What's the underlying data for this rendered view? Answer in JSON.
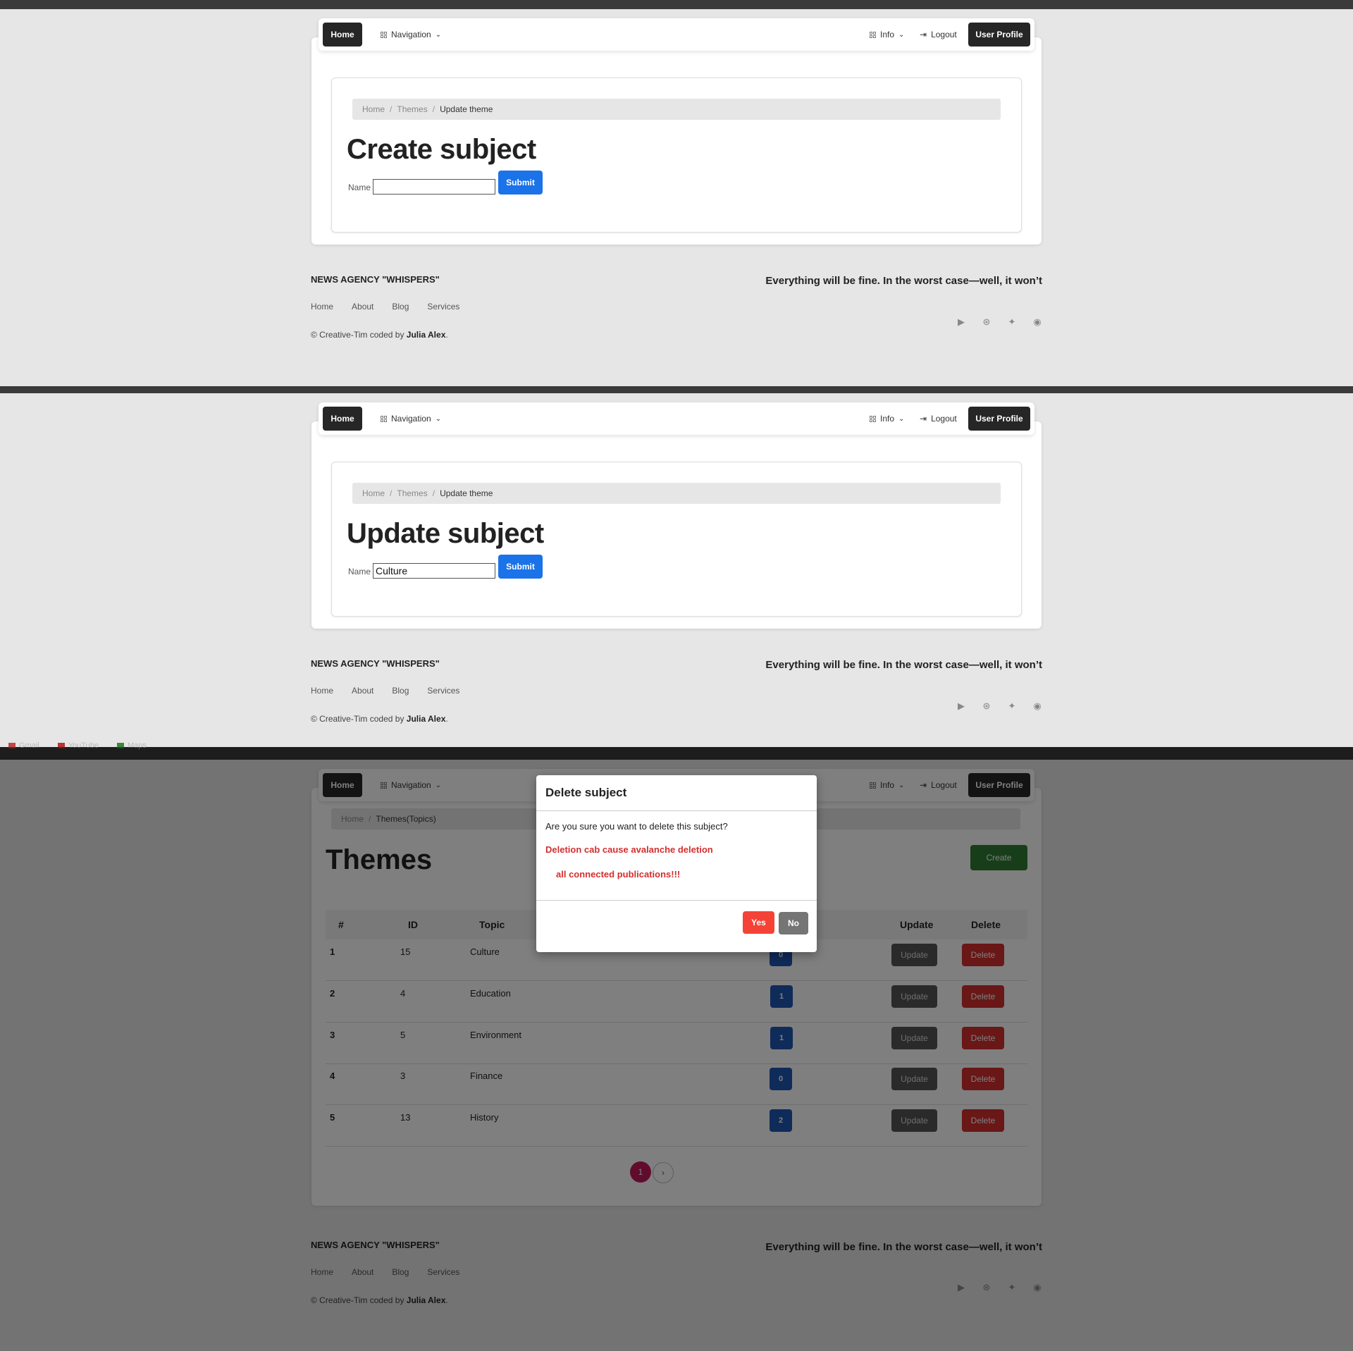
{
  "nav": {
    "home_label": "Home",
    "navigation_label": "Navigation",
    "info_label": "Info",
    "logout_label": "Logout",
    "user_profile_label": "User Profile"
  },
  "breadcrumb_form": {
    "home": "Home",
    "sep": "/",
    "themes": "Themes",
    "current": "Update theme"
  },
  "create_form": {
    "title": "Create subject",
    "name_label": "Name",
    "name_value": "",
    "submit_label": "Submit"
  },
  "update_form": {
    "title": "Update subject",
    "name_label": "Name",
    "name_value": "Culture",
    "submit_label": "Submit"
  },
  "footer": {
    "brand": "NEWS AGENCY \"WHISPERS\"",
    "tagline": "Everything will be fine. In the worst case—well, it won’t",
    "links": [
      "Home",
      "About",
      "Blog",
      "Services"
    ],
    "copy_prefix": "© Creative-Tim coded by ",
    "copy_author": "Julia Alex",
    "copy_suffix": ".",
    "social_icons": [
      "youtube-icon",
      "dribbble-icon",
      "twitter-icon",
      "github-icon"
    ]
  },
  "bookmarks": [
    "Gmail",
    "YouTube",
    "Maps"
  ],
  "themes_page": {
    "breadcrumb_home": "Home",
    "breadcrumb_sep": "/",
    "breadcrumb_current": "Themes(Topics)",
    "title": "Themes",
    "create_label": "Create",
    "columns": [
      "#",
      "ID",
      "Topic",
      "Update",
      "Delete"
    ],
    "rows": [
      {
        "num": "1",
        "id": "15",
        "topic": "Culture",
        "count": "0",
        "update": "Update",
        "delete": "Delete"
      },
      {
        "num": "2",
        "id": "4",
        "topic": "Education",
        "count": "1",
        "update": "Update",
        "delete": "Delete"
      },
      {
        "num": "3",
        "id": "5",
        "topic": "Environment",
        "count": "1",
        "update": "Update",
        "delete": "Delete"
      },
      {
        "num": "4",
        "id": "3",
        "topic": "Finance",
        "count": "0",
        "update": "Update",
        "delete": "Delete"
      },
      {
        "num": "5",
        "id": "13",
        "topic": "History",
        "count": "2",
        "update": "Update",
        "delete": "Delete"
      }
    ],
    "pagination": {
      "current": "1",
      "next": "›"
    }
  },
  "modal": {
    "title": "Delete subject",
    "question": "Are you sure you want to delete this subject?",
    "warning_line1": "Deletion cab cause avalanche deletion",
    "warning_line2": "all connected publications!!!",
    "yes_label": "Yes",
    "no_label": "No"
  },
  "colors": {
    "primary_blue": "#1a73e8",
    "dark_button": "#262626",
    "create_green": "#2e7d32",
    "delete_red": "#d32f2f",
    "yes_red": "#f44336",
    "badge_blue": "#1e56b3",
    "pagination_pink": "#c2185b",
    "warning_text": "#d32f2f"
  }
}
